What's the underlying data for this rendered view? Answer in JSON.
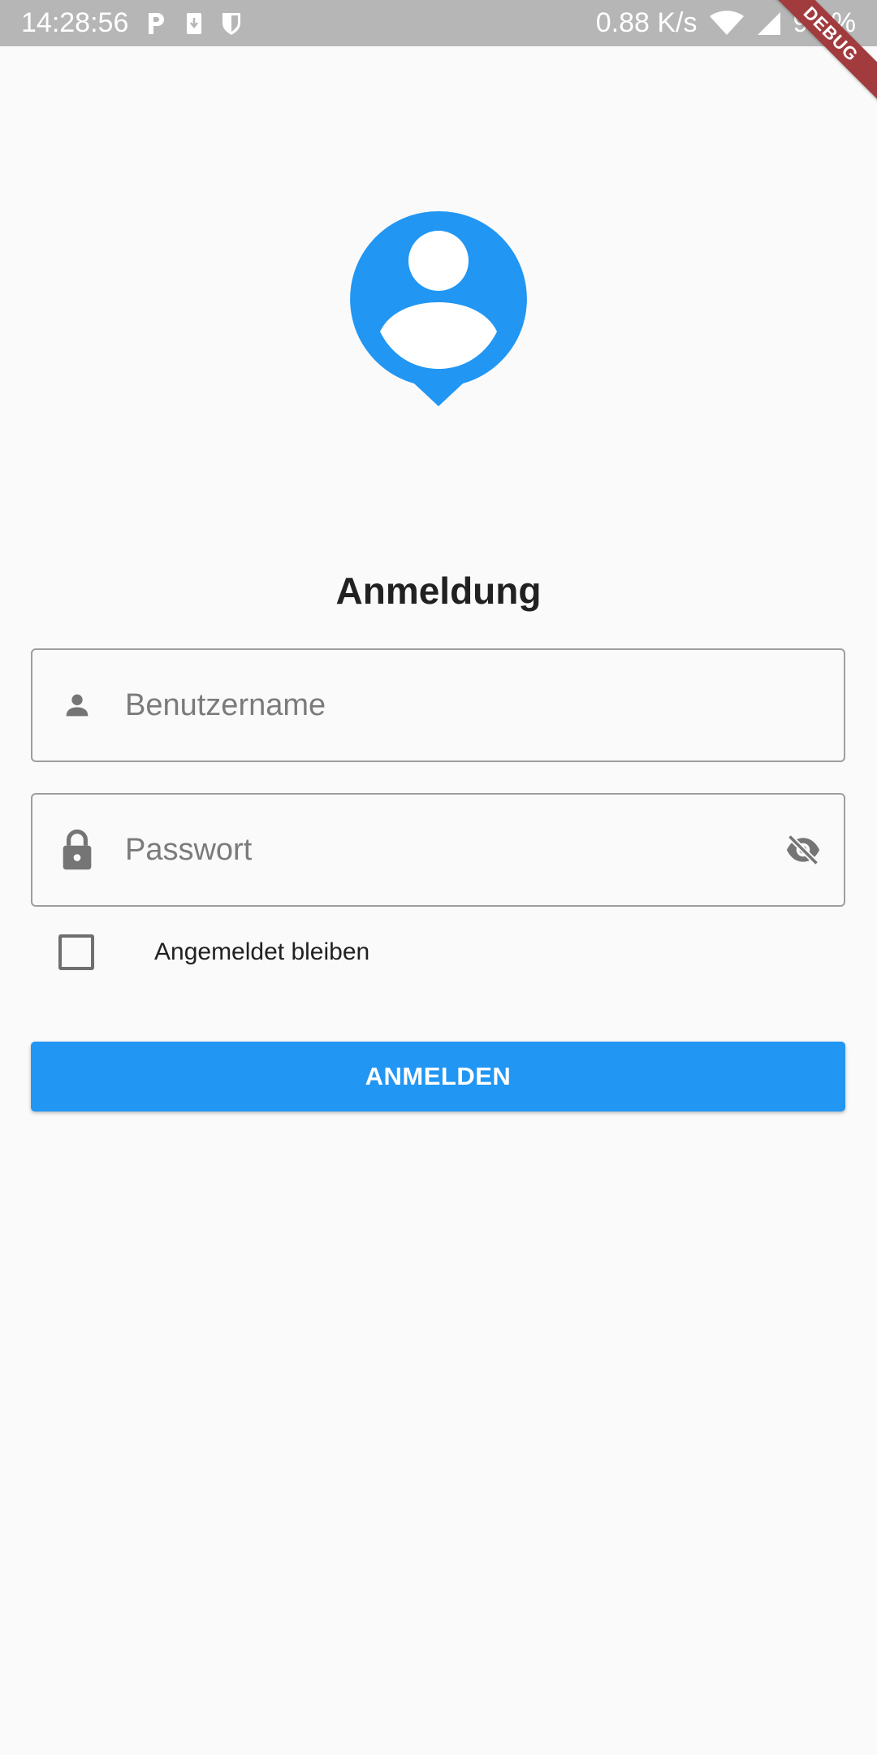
{
  "status_bar": {
    "time": "14:28:56",
    "network_speed": "0.88 K/s",
    "battery": "99 %",
    "icons": [
      "parking-icon",
      "download-icon",
      "shield-icon",
      "wifi-icon",
      "signal-icon"
    ]
  },
  "debug_banner": "DEBUG",
  "logo": {
    "icon": "person-pin-icon",
    "color": "#2196f3"
  },
  "title": "Anmeldung",
  "username_field": {
    "placeholder": "Benutzername",
    "value": "",
    "icon": "person-icon"
  },
  "password_field": {
    "placeholder": "Passwort",
    "value": "",
    "icon": "lock-icon",
    "toggle_icon": "visibility-off-icon"
  },
  "remember_me": {
    "label": "Angemeldet bleiben",
    "checked": false
  },
  "login_button": {
    "label": "ANMELDEN",
    "color": "#2196f3"
  },
  "colors": {
    "accent": "#2196f3",
    "background": "#fafafa",
    "status_bar": "#b6b6b6",
    "debug_ribbon": "#a13b3e"
  }
}
